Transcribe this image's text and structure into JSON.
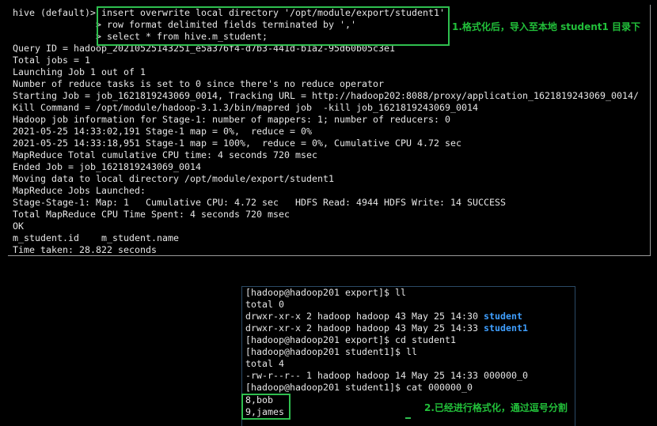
{
  "hive_terminal": {
    "lines": [
      "hive (default)> insert overwrite local directory '/opt/module/export/student1'",
      "               > row format delimited fields terminated by ','",
      "               > select * from hive.m_student;",
      "Query ID = hadoop_20210525143251_e5a376f4-d7b3-441d-b1a2-95d60b05c3e1",
      "Total jobs = 1",
      "Launching Job 1 out of 1",
      "Number of reduce tasks is set to 0 since there's no reduce operator",
      "Starting Job = job_1621819243069_0014, Tracking URL = http://hadoop202:8088/proxy/application_1621819243069_0014/",
      "Kill Command = /opt/module/hadoop-3.1.3/bin/mapred job  -kill job_1621819243069_0014",
      "Hadoop job information for Stage-1: number of mappers: 1; number of reducers: 0",
      "2021-05-25 14:33:02,191 Stage-1 map = 0%,  reduce = 0%",
      "2021-05-25 14:33:18,951 Stage-1 map = 100%,  reduce = 0%, Cumulative CPU 4.72 sec",
      "MapReduce Total cumulative CPU time: 4 seconds 720 msec",
      "Ended Job = job_1621819243069_0014",
      "Moving data to local directory /opt/module/export/student1",
      "MapReduce Jobs Launched:",
      "Stage-Stage-1: Map: 1   Cumulative CPU: 4.72 sec   HDFS Read: 4944 HDFS Write: 14 SUCCESS",
      "Total MapReduce CPU Time Spent: 4 seconds 720 msec",
      "OK",
      "m_student.id    m_student.name",
      "Time taken: 28.822 seconds"
    ]
  },
  "shell_terminal": {
    "line0": "[hadoop@hadoop201 export]$ ll",
    "line1": "total 0",
    "line2_prefix": "drwxr-xr-x 2 hadoop hadoop 43 May 25 14:30 ",
    "line2_dir": "student",
    "line3_prefix": "drwxr-xr-x 2 hadoop hadoop 43 May 25 14:33 ",
    "line3_dir": "student1",
    "line4": "[hadoop@hadoop201 export]$ cd student1",
    "line5": "[hadoop@hadoop201 student1]$ ll",
    "line6": "total 4",
    "line7": "-rw-r--r-- 1 hadoop hadoop 14 May 25 14:33 000000_0",
    "line8": "[hadoop@hadoop201 student1]$ cat 000000_0",
    "line9": "8,bob",
    "line10": "9,james"
  },
  "annotations": {
    "note1": "1.格式化后，导入至本地 student1 目录下",
    "note2": "2.已经进行格式化，通过逗号分割"
  },
  "colors": {
    "terminal_text": "#e6e6e6",
    "directory": "#3f9fff",
    "highlight_box": "#2fbf4f",
    "annotation_text": "#22c03a"
  }
}
